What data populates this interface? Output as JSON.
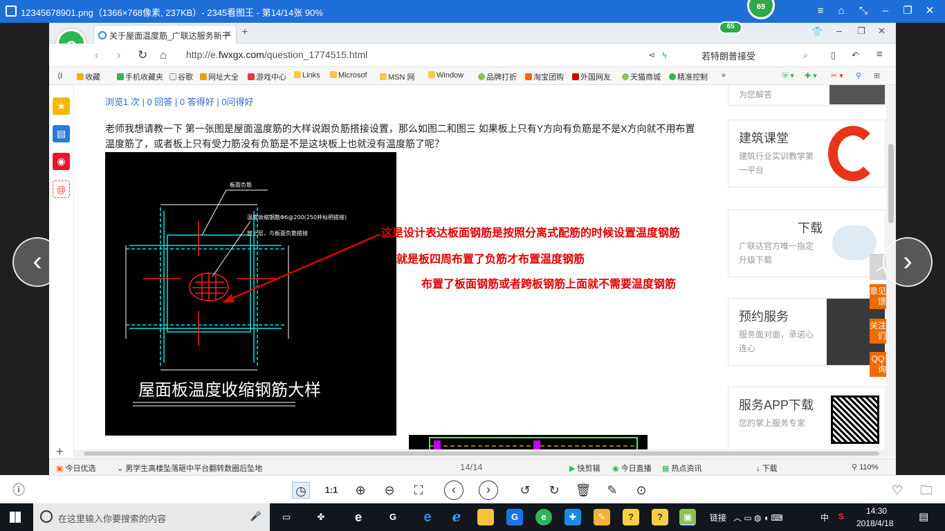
{
  "viewer": {
    "title": "12345678901.png（1366×768像素, 237KB）- 2345看图王 - 第14/14张 90%",
    "badge_top": "69",
    "badge_inner": "65",
    "page_counter": "14/14"
  },
  "browser": {
    "tab_title": "关于屋面温度筋_广联达服务新干",
    "url_prefix": "http://e.",
    "url_host": "fwxgx.com",
    "url_path": "/question_1774515.html",
    "search_text": "若特朗普接受",
    "bookmarks": [
      "收藏",
      "手机收藏夹",
      "谷歌",
      "网址大全",
      "游戏中心",
      "Links",
      "Microsof",
      "MSN 网",
      "Window",
      "品牌打折",
      "淘宝团购",
      "外国网友",
      "天猫商城",
      "精准控制"
    ],
    "bookmark_more": "»",
    "bookmark_left": "⟨I"
  },
  "page": {
    "stats": "浏览1 次 | 0 回答 | 0 答得好 | 0问得好",
    "question": "老师我想请教一下 第一张图是屋面温度筋的大样说跟负筋搭接设置，那么如图二和图三 如果板上只有Y方向有负筋是不是X方向就不用布置温度筋了，或者板上只有受力筋没有负筋是不是这块板上也就没有温度筋了呢？",
    "cad_caption": "屋面板温度收缩钢筋大样",
    "cad_label1": "板面负筋",
    "cad_label2": "温度收缩钢筋Φ6@200(250并标明搭接)",
    "cad_label3": "放上层，与板面负筋搭接",
    "annotation1": "这是设计表达板面钢筋是按照分离式配筋的时候设置温度钢筋",
    "annotation2": "就是板四周布置了负筋才布置温度钢筋",
    "annotation3": "布置了板面钢筋或者跨板钢筋上面就不需要温度钢筋"
  },
  "right_column": {
    "top_snippet": "为您解答",
    "cards": [
      {
        "title": "建筑课堂",
        "sub": "建筑行业实训教学第一平台"
      },
      {
        "title": "下载",
        "sub": "广联达官方唯一指定升级下载"
      },
      {
        "title": "预约服务",
        "sub": "服务面对面，承诺心连心"
      },
      {
        "title": "服务APP下载",
        "sub": "您的掌上服务专家"
      }
    ],
    "float_buttons": [
      "意见反馈",
      "关注我们",
      "QQ咨询"
    ]
  },
  "statusbar": {
    "today_pick": "今日优选",
    "news": "男学生高楼坠落砸中平台翻转数圈后坠地",
    "items": [
      "快剪辑",
      "今日直播",
      "热点资讯",
      "下载"
    ],
    "zoom": "110%"
  },
  "viewer_toolbar": {
    "ratio_label": "1:1"
  },
  "taskbar": {
    "search_placeholder": "在这里输入你要搜索的内容",
    "link_label": "链接",
    "ime": "中",
    "time": "14:30",
    "date": "2018/4/18"
  },
  "colors": {
    "accent": "#1e6fd8",
    "annotation": "#e10000",
    "brand_green": "#2fb553",
    "float_orange": "#f16a00"
  }
}
